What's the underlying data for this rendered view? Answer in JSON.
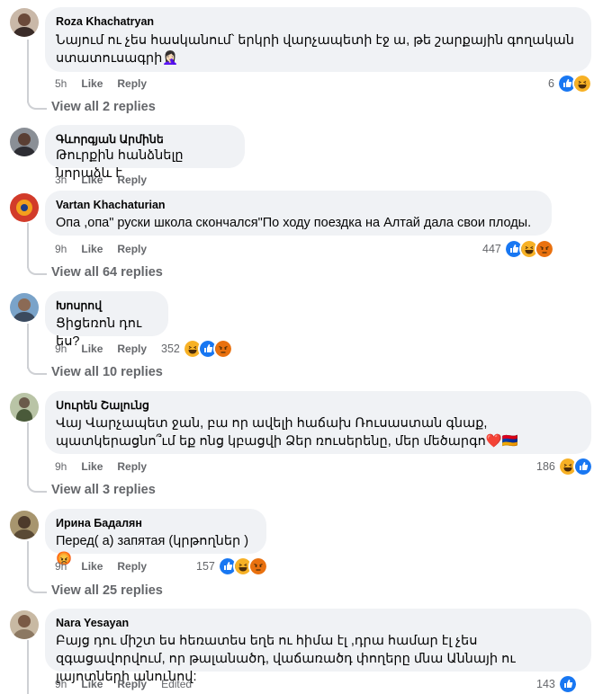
{
  "actions": {
    "like": "Like",
    "reply": "Reply",
    "edited": "Edited"
  },
  "comments": [
    {
      "author": "Roza Khachatryan",
      "text": "Նայում ու չես հասկանում՝ երկրի վարչապետի էջ ա, թե շարքային գողական ստատուսագրի🤦🏻‍♀️",
      "time": "5h",
      "reactions": "6",
      "view_replies": "View all 2 replies"
    },
    {
      "author": "Գևորգյան Արմինե",
      "text": "Թուրքին հանձնելը նորաձև է",
      "time": "3h",
      "reactions": "",
      "view_replies": ""
    },
    {
      "author": "Vartan Khachaturian",
      "text": "Опа ,опа\" руски школа скончался\"По ходу поездка на Алтай дала свои плоды.",
      "time": "9h",
      "reactions": "447",
      "view_replies": "View all 64 replies"
    },
    {
      "author": "Խոսրով",
      "text": "Ցիցեռոն դու ես?",
      "time": "9h",
      "reactions": "352",
      "view_replies": "View all 10 replies"
    },
    {
      "author": "Սուրեն Շալունց",
      "text": "Վայ Վարչապետ ջան, բա որ ավելի հաճախ Ռուսաստան գնաք, պատկերացնո՞ւմ եք ոնց կբացվի Ձեր ռուսերենը, մեր մեծարգո❤️🇦🇲",
      "time": "9h",
      "reactions": "186",
      "view_replies": "View all 3 replies"
    },
    {
      "author": "Ирина Бадалян",
      "text": "Перед( а) запятая (կրթողներ )😡",
      "time": "9h",
      "reactions": "157",
      "view_replies": "View all 25 replies"
    },
    {
      "author": "Nara Yesayan",
      "text": "Բայց դու միշտ ես հեռատես եղե ու հիմա էլ ,դրա համար էլ չես զգացավորվում, որ թալանածդ, վաճառածդ փողերը մնա Աննայի ու լայոտների անունով:",
      "time": "9h",
      "reactions": "143",
      "view_replies": ""
    }
  ],
  "colors": {
    "like": "#1877f2",
    "haha": "#f7b125",
    "angry": "#e9710f",
    "bubble": "#f0f2f5",
    "meta": "#65676b"
  },
  "icons": [
    "like-icon",
    "haha-icon",
    "angry-icon"
  ]
}
